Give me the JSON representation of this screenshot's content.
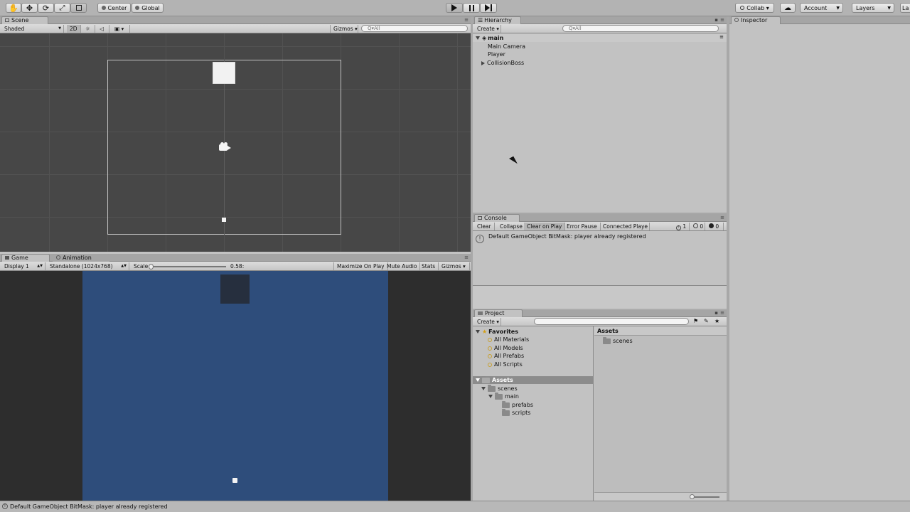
{
  "toolbar": {
    "tools": [
      "hand-tool-icon",
      "move-tool-icon",
      "rotate-tool-icon",
      "scale-tool-icon",
      "rect-tool-icon"
    ],
    "pivot_label": "Center",
    "space_label": "Global",
    "collab_label": "Collab ▾",
    "account_label": "Account",
    "layers_label": "Layers",
    "layout_label": "La"
  },
  "scene": {
    "tab": "Scene",
    "shading": "Shaded",
    "mode_2d": "2D",
    "gizmos": "Gizmos",
    "search_placeholder": "Q▾All"
  },
  "game": {
    "tab": "Game",
    "tab_animation": "Animation",
    "display": "Display 1",
    "resolution": "Standalone (1024x768)",
    "scale_label": "Scale",
    "scale_value": "0.58:",
    "maximize": "Maximize On Play",
    "mute": "Mute Audio",
    "stats": "Stats",
    "gizmos": "Gizmos"
  },
  "hierarchy": {
    "tab": "Hierarchy",
    "create": "Create",
    "search_placeholder": "Q▾All",
    "scene_name": "main",
    "items": [
      "Main Camera",
      "Player",
      "CollisionBoss"
    ]
  },
  "console": {
    "tab": "Console",
    "buttons": [
      "Clear",
      "Collapse",
      "Clear on Play",
      "Error Pause",
      "Connected Playe"
    ],
    "counts": [
      "1",
      "0",
      "0"
    ],
    "message": "Default GameObject BitMask: player already registered"
  },
  "project": {
    "tab": "Project",
    "create": "Create",
    "favorites_label": "Favorites",
    "favorites": [
      "All Materials",
      "All Models",
      "All Prefabs",
      "All Scripts"
    ],
    "assets_label": "Assets",
    "tree": [
      "scenes",
      "main",
      "prefabs",
      "scripts"
    ],
    "right_header": "Assets",
    "right_items": [
      "scenes"
    ]
  },
  "inspector": {
    "tab": "Inspector"
  },
  "statusbar": {
    "message": "Default GameObject BitMask: player already registered"
  },
  "colors": {
    "game_bg": "#2e4d7b",
    "scene_bg": "#474747",
    "editor_bg": "#c2c2c2"
  }
}
